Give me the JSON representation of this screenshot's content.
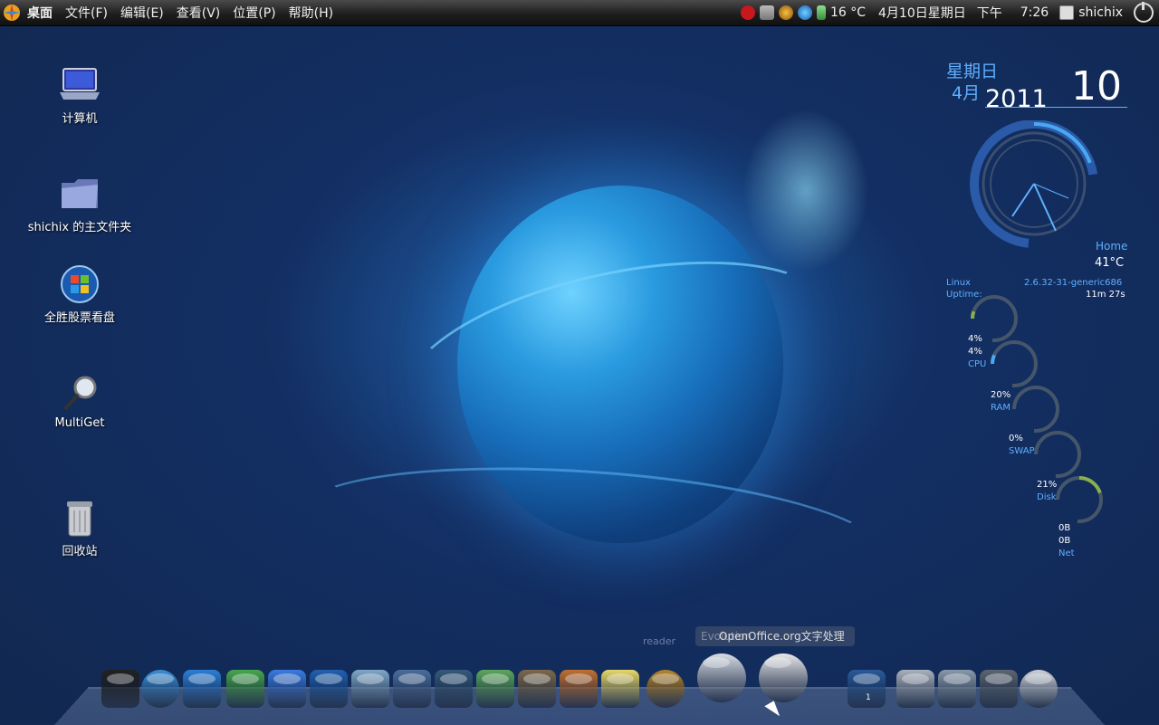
{
  "panel": {
    "menus": [
      "桌面",
      "文件(F)",
      "编辑(E)",
      "查看(V)",
      "位置(P)",
      "帮助(H)"
    ],
    "weather": "16 °C",
    "date": "4月10日星期日",
    "ampm": "下午",
    "time": "7:26",
    "user": "shichix"
  },
  "desktop_icons": [
    {
      "label": "计算机",
      "icon": "laptop-icon"
    },
    {
      "label": "shichix 的主文件夹",
      "icon": "home-folder-icon"
    },
    {
      "label": "全胜股票看盘",
      "icon": "windows-logo-icon"
    },
    {
      "label": "MultiGet",
      "icon": "magnifier-icon"
    },
    {
      "label": "回收站",
      "icon": "trash-icon"
    }
  ],
  "clock": {
    "weekday": "星期日",
    "month": "4月",
    "year": "2011",
    "day": "10"
  },
  "sysmon": {
    "home": "Home",
    "temp": "41°C",
    "os_label": "Linux",
    "kernel": "2.6.32-31-generic686",
    "uptime_label": "Uptime:",
    "uptime": "11m 27s",
    "cpu1": "4%",
    "cpu2": "4%",
    "cpu_label": "CPU",
    "ram": "20%",
    "ram_label": "RAM",
    "swap": "0%",
    "swap_label": "SWAP",
    "disk": "21%",
    "disk_label": "Disk",
    "net1": "0B",
    "net2": "0B",
    "net_label": "Net"
  },
  "dock": {
    "tooltip": "OpenOffice.org文字处理",
    "tooltip_behind": "Evolution",
    "faint_label": "reader",
    "workspace_num": "1",
    "items": [
      {
        "icon": "terminal-icon",
        "color": "#222"
      },
      {
        "icon": "safari-compass-icon",
        "color": "#3a8fd8"
      },
      {
        "icon": "internet-explorer-icon",
        "color": "#2b7fd6"
      },
      {
        "icon": "messenger-icon",
        "color": "#47a84a"
      },
      {
        "icon": "qq-penguin-icon",
        "color": "#3b7be0"
      },
      {
        "icon": "clapperboard-icon",
        "color": "#2160b0"
      },
      {
        "icon": "video-converter-icon",
        "color": "#7fa8c8"
      },
      {
        "icon": "film-reel-icon",
        "color": "#4c6e9c"
      },
      {
        "icon": "system-monitor-icon",
        "color": "#355a7a"
      },
      {
        "icon": "text-editor-icon",
        "color": "#5da85a"
      },
      {
        "icon": "image-viewer-icon",
        "color": "#7d6a4a"
      },
      {
        "icon": "photo-camera-icon",
        "color": "#c07030"
      },
      {
        "icon": "sticky-notes-icon",
        "color": "#e8d868"
      },
      {
        "icon": "compass-icon",
        "color": "#b8862a"
      },
      {
        "icon": "mail-envelope-icon",
        "color": "#d8dde4"
      },
      {
        "icon": "writer-document-icon",
        "color": "#e8e8e8"
      },
      {
        "icon": "workspace-switcher-icon",
        "color": "#2a5a9a"
      },
      {
        "icon": "at-mail-icon",
        "color": "#aab2bc"
      },
      {
        "icon": "robot-arm-icon",
        "color": "#8a9aaa"
      },
      {
        "icon": "settings-icon",
        "color": "#5d6670"
      },
      {
        "icon": "power-icon",
        "color": "#cfd4da"
      }
    ]
  }
}
